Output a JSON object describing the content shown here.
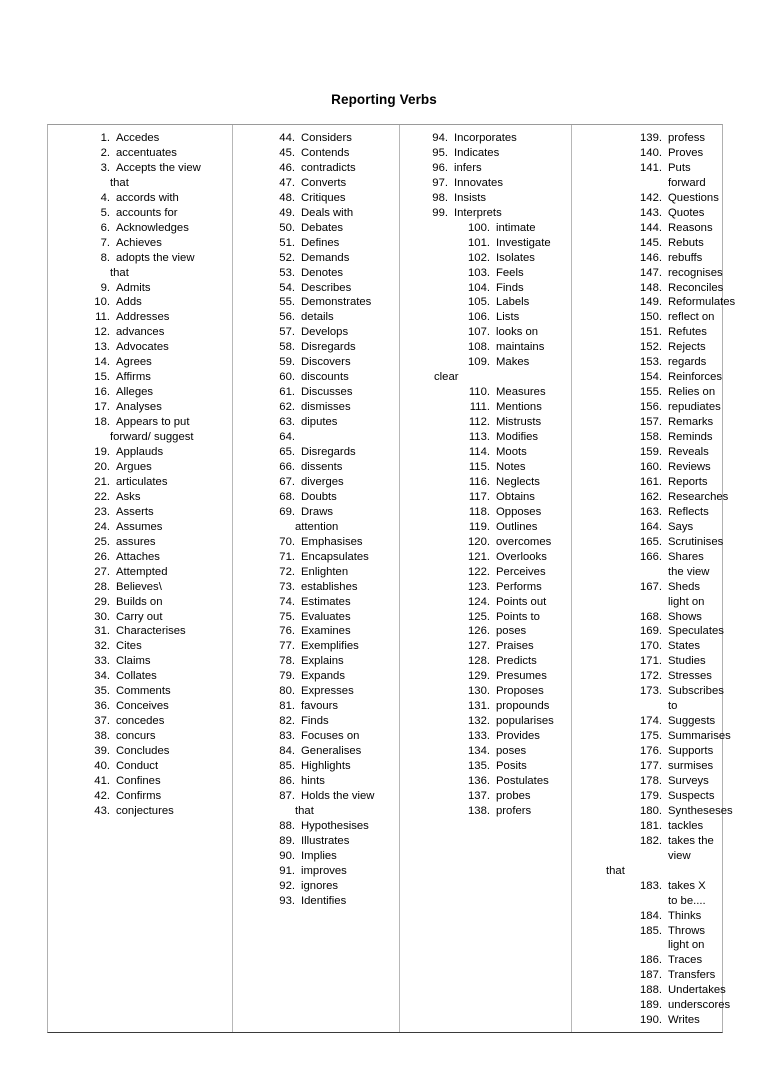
{
  "document": {
    "title": "Reporting Verbs"
  },
  "table": {
    "columns": [
      {
        "name": "column-1",
        "items": [
          {
            "num": "1.",
            "label": "Accedes"
          },
          {
            "num": "2.",
            "label": "accentuates"
          },
          {
            "num": "3.",
            "label": "Accepts the view",
            "cont": "that"
          },
          {
            "num": "4.",
            "label": "accords with"
          },
          {
            "num": "5.",
            "label": "accounts for"
          },
          {
            "num": "6.",
            "label": "Acknowledges"
          },
          {
            "num": "7.",
            "label": "Achieves"
          },
          {
            "num": "8.",
            "label": "adopts the view",
            "cont": "that"
          },
          {
            "num": "9.",
            "label": "Admits"
          },
          {
            "num": "10.",
            "label": "Adds"
          },
          {
            "num": "11.",
            "label": "Addresses"
          },
          {
            "num": "12.",
            "label": "advances"
          },
          {
            "num": "13.",
            "label": "Advocates"
          },
          {
            "num": "14.",
            "label": "Agrees"
          },
          {
            "num": "15.",
            "label": "Affirms"
          },
          {
            "num": "16.",
            "label": "Alleges"
          },
          {
            "num": "17.",
            "label": "Analyses"
          },
          {
            "num": "18.",
            "label": "Appears to put",
            "cont": "forward/ suggest"
          },
          {
            "num": "19.",
            "label": "Applauds"
          },
          {
            "num": "20.",
            "label": "Argues"
          },
          {
            "num": "21.",
            "label": "articulates"
          },
          {
            "num": "22.",
            "label": "Asks"
          },
          {
            "num": "23.",
            "label": "Asserts"
          },
          {
            "num": "24.",
            "label": "Assumes"
          },
          {
            "num": "25.",
            "label": "assures"
          },
          {
            "num": "26.",
            "label": "Attaches"
          },
          {
            "num": "27.",
            "label": "Attempted"
          },
          {
            "num": "28.",
            "label": "Believes\\"
          },
          {
            "num": "29.",
            "label": "Builds on"
          },
          {
            "num": "30.",
            "label": "Carry out"
          },
          {
            "num": "31.",
            "label": "Characterises"
          },
          {
            "num": "32.",
            "label": "Cites"
          },
          {
            "num": "33.",
            "label": "Claims"
          },
          {
            "num": "34.",
            "label": "Collates"
          },
          {
            "num": "35.",
            "label": "Comments"
          },
          {
            "num": "36.",
            "label": "Conceives"
          },
          {
            "num": "37.",
            "label": "concedes"
          },
          {
            "num": "38.",
            "label": "concurs"
          },
          {
            "num": "39.",
            "label": "Concludes"
          },
          {
            "num": "40.",
            "label": "Conduct"
          },
          {
            "num": "41.",
            "label": "Confines"
          },
          {
            "num": "42.",
            "label": "Confirms"
          },
          {
            "num": "43.",
            "label": "conjectures"
          }
        ]
      },
      {
        "name": "column-2",
        "items": [
          {
            "num": "44.",
            "label": "Considers"
          },
          {
            "num": "45.",
            "label": "Contends"
          },
          {
            "num": "46.",
            "label": "contradicts"
          },
          {
            "num": "47.",
            "label": "Converts"
          },
          {
            "num": "48.",
            "label": "Critiques"
          },
          {
            "num": "49.",
            "label": "Deals with"
          },
          {
            "num": "50.",
            "label": "Debates"
          },
          {
            "num": "51.",
            "label": "Defines"
          },
          {
            "num": "52.",
            "label": "Demands"
          },
          {
            "num": "53.",
            "label": "Denotes"
          },
          {
            "num": "54.",
            "label": "Describes"
          },
          {
            "num": "55.",
            "label": "Demonstrates"
          },
          {
            "num": "56.",
            "label": "details"
          },
          {
            "num": "57.",
            "label": "Develops"
          },
          {
            "num": "58.",
            "label": "Disregards"
          },
          {
            "num": "59.",
            "label": "Discovers"
          },
          {
            "num": "60.",
            "label": "discounts"
          },
          {
            "num": "61.",
            "label": "Discusses"
          },
          {
            "num": "62.",
            "label": "dismisses"
          },
          {
            "num": "63.",
            "label": "diputes"
          },
          {
            "num": "64.",
            "label": ""
          },
          {
            "num": "65.",
            "label": "Disregards"
          },
          {
            "num": "66.",
            "label": "dissents"
          },
          {
            "num": "67.",
            "label": "diverges"
          },
          {
            "num": "68.",
            "label": "Doubts"
          },
          {
            "num": "69.",
            "label": "Draws",
            "cont": "attention"
          },
          {
            "num": "70.",
            "label": "Emphasises"
          },
          {
            "num": "71.",
            "label": "Encapsulates"
          },
          {
            "num": "72.",
            "label": "Enlighten"
          },
          {
            "num": "73.",
            "label": "establishes"
          },
          {
            "num": "74.",
            "label": "Estimates"
          },
          {
            "num": "75.",
            "label": "Evaluates"
          },
          {
            "num": "76.",
            "label": "Examines"
          },
          {
            "num": "77.",
            "label": "Exemplifies"
          },
          {
            "num": "78.",
            "label": "Explains"
          },
          {
            "num": "79.",
            "label": "Expands"
          },
          {
            "num": "80.",
            "label": "Expresses"
          },
          {
            "num": "81.",
            "label": "favours"
          },
          {
            "num": "82.",
            "label": "Finds"
          },
          {
            "num": "83.",
            "label": "Focuses on"
          },
          {
            "num": "84.",
            "label": "Generalises"
          },
          {
            "num": "85.",
            "label": "Highlights"
          },
          {
            "num": "86.",
            "label": "hints"
          },
          {
            "num": "87.",
            "label": "Holds the view",
            "cont": "that"
          },
          {
            "num": "88.",
            "label": "Hypothesises"
          },
          {
            "num": "89.",
            "label": "Illustrates"
          },
          {
            "num": "90.",
            "label": "Implies"
          },
          {
            "num": "91.",
            "label": "improves"
          },
          {
            "num": "92.",
            "label": "ignores"
          },
          {
            "num": "93.",
            "label": "Identifies"
          }
        ]
      },
      {
        "name": "column-3",
        "items": [
          {
            "num": "94.",
            "label": "Incorporates"
          },
          {
            "num": "95.",
            "label": "Indicates"
          },
          {
            "num": "96.",
            "label": "infers"
          },
          {
            "num": "97.",
            "label": "Innovates"
          },
          {
            "num": "98.",
            "label": "Insists"
          },
          {
            "num": "99.",
            "label": "Interprets"
          },
          {
            "num": "100.",
            "label": "intimate",
            "wide": true
          },
          {
            "num": "101.",
            "label": "Investigate",
            "wide": true
          },
          {
            "num": "102.",
            "label": "Isolates",
            "wide": true
          },
          {
            "num": "103.",
            "label": "Feels",
            "wide": true
          },
          {
            "num": "104.",
            "label": "Finds",
            "wide": true
          },
          {
            "num": "105.",
            "label": "Labels",
            "wide": true
          },
          {
            "num": "106.",
            "label": "Lists",
            "wide": true
          },
          {
            "num": "107.",
            "label": "looks on",
            "wide": true
          },
          {
            "num": "108.",
            "label": "maintains",
            "wide": true
          },
          {
            "num": "109.",
            "label": "Makes",
            "wide": true,
            "cont": "clear"
          },
          {
            "num": "110.",
            "label": "Measures",
            "wide": true
          },
          {
            "num": "111.",
            "label": "Mentions",
            "wide": true
          },
          {
            "num": "112.",
            "label": "Mistrusts",
            "wide": true
          },
          {
            "num": "113.",
            "label": "Modifies",
            "wide": true
          },
          {
            "num": "114.",
            "label": "Moots",
            "wide": true
          },
          {
            "num": "115.",
            "label": "Notes",
            "wide": true
          },
          {
            "num": "116.",
            "label": "Neglects",
            "wide": true
          },
          {
            "num": "117.",
            "label": "Obtains",
            "wide": true
          },
          {
            "num": "118.",
            "label": "Opposes",
            "wide": true
          },
          {
            "num": "119.",
            "label": "Outlines",
            "wide": true
          },
          {
            "num": "120.",
            "label": "overcomes",
            "wide": true
          },
          {
            "num": "121.",
            "label": "Overlooks",
            "wide": true
          },
          {
            "num": "122.",
            "label": "Perceives",
            "wide": true
          },
          {
            "num": "123.",
            "label": "Performs",
            "wide": true
          },
          {
            "num": "124.",
            "label": "Points out",
            "wide": true
          },
          {
            "num": "125.",
            "label": "Points to",
            "wide": true
          },
          {
            "num": "126.",
            "label": "poses",
            "wide": true
          },
          {
            "num": "127.",
            "label": "Praises",
            "wide": true
          },
          {
            "num": "128.",
            "label": "Predicts",
            "wide": true
          },
          {
            "num": "129.",
            "label": "Presumes",
            "wide": true
          },
          {
            "num": "130.",
            "label": "Proposes",
            "wide": true
          },
          {
            "num": "131.",
            "label": "propounds",
            "wide": true
          },
          {
            "num": "132.",
            "label": "popularises",
            "wide": true
          },
          {
            "num": "133.",
            "label": "Provides",
            "wide": true
          },
          {
            "num": "134.",
            "label": "poses",
            "wide": true
          },
          {
            "num": "135.",
            "label": "Posits",
            "wide": true
          },
          {
            "num": "136.",
            "label": "Postulates",
            "wide": true
          },
          {
            "num": "137.",
            "label": "probes",
            "wide": true
          },
          {
            "num": "138.",
            "label": "profers",
            "wide": true
          }
        ]
      },
      {
        "name": "column-4",
        "items": [
          {
            "num": "139.",
            "label": "profess"
          },
          {
            "num": "140.",
            "label": "Proves"
          },
          {
            "num": "141.",
            "label": "Puts forward"
          },
          {
            "num": "142.",
            "label": "Questions"
          },
          {
            "num": "143.",
            "label": "Quotes"
          },
          {
            "num": "144.",
            "label": "Reasons"
          },
          {
            "num": "145.",
            "label": "Rebuts"
          },
          {
            "num": "146.",
            "label": "rebuffs"
          },
          {
            "num": "147.",
            "label": "recognises"
          },
          {
            "num": "148.",
            "label": "Reconciles"
          },
          {
            "num": "149.",
            "label": "Reformulates"
          },
          {
            "num": "150.",
            "label": "reflect on"
          },
          {
            "num": "151.",
            "label": "Refutes"
          },
          {
            "num": "152.",
            "label": "Rejects"
          },
          {
            "num": "153.",
            "label": "regards"
          },
          {
            "num": "154.",
            "label": "Reinforces"
          },
          {
            "num": "155.",
            "label": "Relies on"
          },
          {
            "num": "156.",
            "label": "repudiates"
          },
          {
            "num": "157.",
            "label": "Remarks"
          },
          {
            "num": "158.",
            "label": "Reminds"
          },
          {
            "num": "159.",
            "label": "Reveals"
          },
          {
            "num": "160.",
            "label": "Reviews"
          },
          {
            "num": "161.",
            "label": "Reports"
          },
          {
            "num": "162.",
            "label": "Researches"
          },
          {
            "num": "163.",
            "label": "Reflects"
          },
          {
            "num": "164.",
            "label": "Says"
          },
          {
            "num": "165.",
            "label": "Scrutinises"
          },
          {
            "num": "166.",
            "label": "Shares the view"
          },
          {
            "num": "167.",
            "label": "Sheds light on"
          },
          {
            "num": "168.",
            "label": "Shows"
          },
          {
            "num": "169.",
            "label": "Speculates"
          },
          {
            "num": "170.",
            "label": "States"
          },
          {
            "num": "171.",
            "label": "Studies"
          },
          {
            "num": "172.",
            "label": "Stresses"
          },
          {
            "num": "173.",
            "label": "Subscribes to"
          },
          {
            "num": "174.",
            "label": "Suggests"
          },
          {
            "num": "175.",
            "label": "Summarises"
          },
          {
            "num": "176.",
            "label": "Supports"
          },
          {
            "num": "177.",
            "label": "surmises"
          },
          {
            "num": "178.",
            "label": "Surveys"
          },
          {
            "num": "179.",
            "label": "Suspects"
          },
          {
            "num": "180.",
            "label": "Syntheseses"
          },
          {
            "num": "181.",
            "label": "tackles"
          },
          {
            "num": "182.",
            "label": "takes the view",
            "cont": "that"
          },
          {
            "num": "183.",
            "label": "takes X to be...."
          },
          {
            "num": "184.",
            "label": "Thinks"
          },
          {
            "num": "185.",
            "label": "Throws light on"
          },
          {
            "num": "186.",
            "label": "Traces"
          },
          {
            "num": "187.",
            "label": "Transfers"
          },
          {
            "num": "188.",
            "label": "Undertakes"
          },
          {
            "num": "189.",
            "label": "underscores"
          },
          {
            "num": "190.",
            "label": "Writes"
          }
        ]
      }
    ]
  }
}
